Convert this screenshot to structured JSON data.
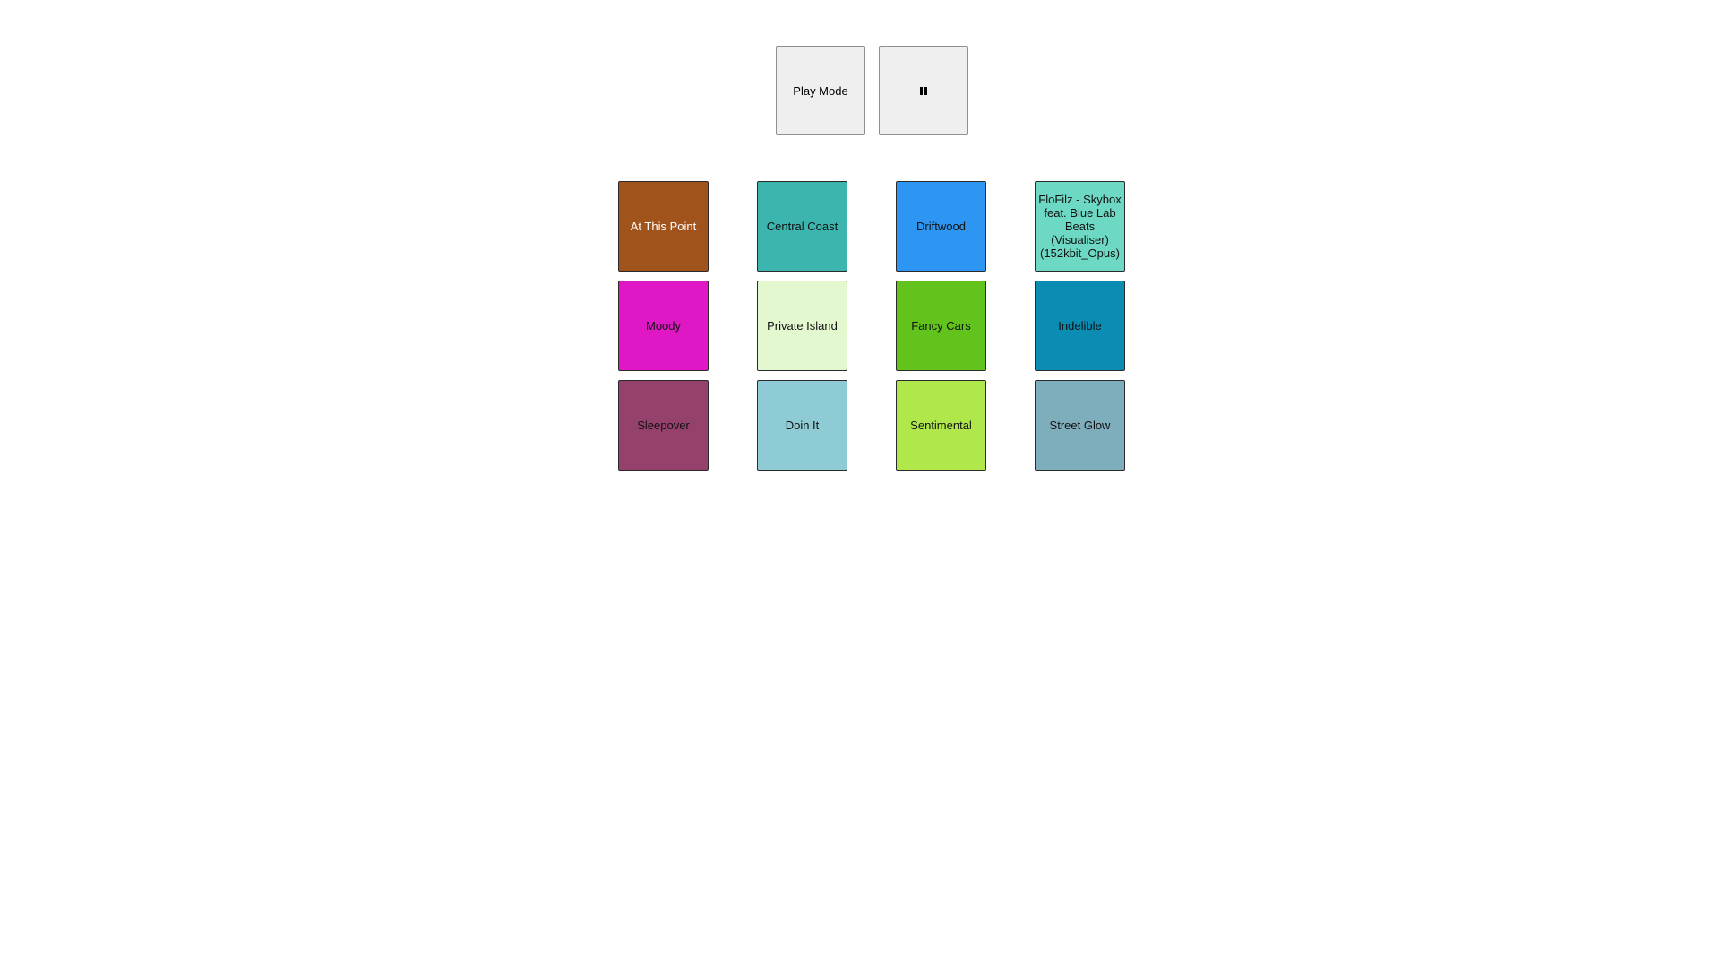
{
  "controls": {
    "play_mode_label": "Play Mode",
    "pause_icon": "pause-icon"
  },
  "pads": [
    {
      "label": "At This Point",
      "color": "#a0531a",
      "text_color": "#ffffff"
    },
    {
      "label": "Central Coast",
      "color": "#3bb5ad",
      "text_color": "#111111"
    },
    {
      "label": "Driftwood",
      "color": "#2d96f2",
      "text_color": "#111111"
    },
    {
      "label": "FloFilz - Skybox feat. Blue Lab Beats (Visualiser) (152kbit_Opus)",
      "color": "#6dd9c4",
      "text_color": "#111111"
    },
    {
      "label": "Moody",
      "color": "#e017c4",
      "text_color": "#111111"
    },
    {
      "label": "Private Island",
      "color": "#e4f8cf",
      "text_color": "#111111"
    },
    {
      "label": "Fancy Cars",
      "color": "#62c31c",
      "text_color": "#111111"
    },
    {
      "label": "Indelible",
      "color": "#0a8cb3",
      "text_color": "#111111"
    },
    {
      "label": "Sleepover",
      "color": "#94426c",
      "text_color": "#111111"
    },
    {
      "label": "Doin It",
      "color": "#8fcbd4",
      "text_color": "#111111"
    },
    {
      "label": "Sentimental",
      "color": "#b0e84c",
      "text_color": "#111111"
    },
    {
      "label": "Street Glow",
      "color": "#7eaebc",
      "text_color": "#111111"
    }
  ]
}
